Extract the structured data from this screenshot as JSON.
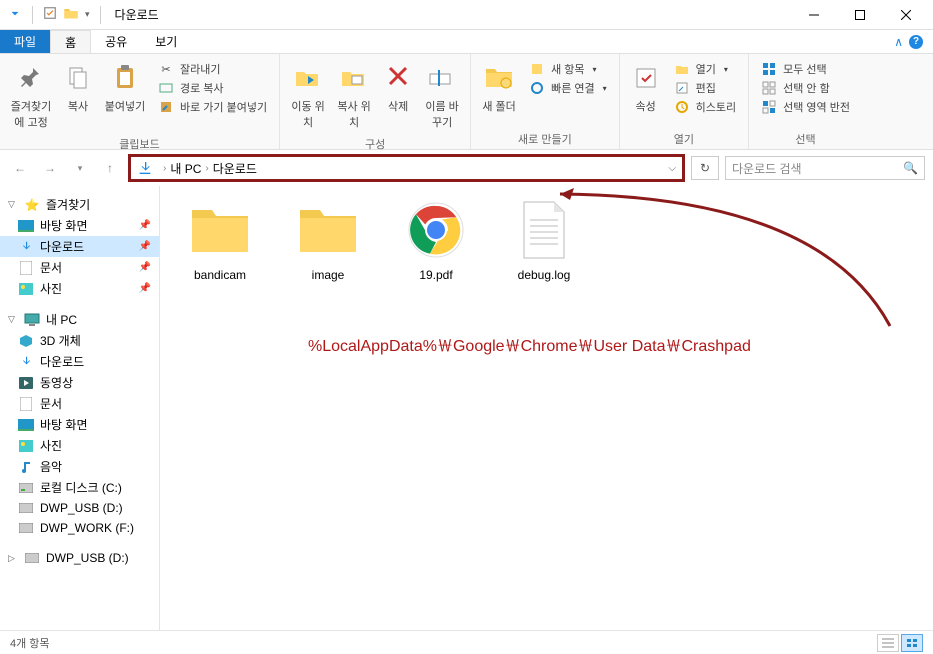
{
  "title": "다운로드",
  "tabs": {
    "file": "파일",
    "home": "홈",
    "share": "공유",
    "view": "보기"
  },
  "ribbon": {
    "clipboard": {
      "label": "클립보드",
      "pin": "즐겨찾기에 고정",
      "copy": "복사",
      "paste": "붙여넣기",
      "cut": "잘라내기",
      "copypath": "경로 복사",
      "pasteshortcut": "바로 가기 붙여넣기"
    },
    "organize": {
      "label": "구성",
      "moveto": "이동 위치",
      "copyto": "복사 위치",
      "delete": "삭제",
      "rename": "이름 바꾸기"
    },
    "new": {
      "label": "새로 만들기",
      "newfolder": "새 폴더",
      "newitem": "새 항목",
      "easyaccess": "빠른 연결"
    },
    "open": {
      "label": "열기",
      "properties": "속성",
      "open": "열기",
      "edit": "편집",
      "history": "히스토리"
    },
    "select": {
      "label": "선택",
      "all": "모두 선택",
      "none": "선택 안 함",
      "invert": "선택 영역 반전"
    }
  },
  "breadcrumb": {
    "pc": "내 PC",
    "downloads": "다운로드"
  },
  "search_placeholder": "다운로드 검색",
  "tree": {
    "quick": "즐겨찾기",
    "desktop": "바탕 화면",
    "downloads": "다운로드",
    "documents": "문서",
    "pictures": "사진",
    "thispc": "내 PC",
    "objects3d": "3D 개체",
    "downloads2": "다운로드",
    "videos": "동영상",
    "documents2": "문서",
    "desktop2": "바탕 화면",
    "pictures2": "사진",
    "music": "음악",
    "localdisk": "로컬 디스크 (C:)",
    "dwpusb": "DWP_USB (D:)",
    "dwpwork": "DWP_WORK (F:)",
    "dwpusb2": "DWP_USB (D:)"
  },
  "files": {
    "bandicam": "bandicam",
    "image": "image",
    "pdf": "19.pdf",
    "debuglog": "debug.log"
  },
  "annotation": "%LocalAppData%￦Google￦Chrome￦User Data￦Crashpad",
  "status": "4개 항목"
}
